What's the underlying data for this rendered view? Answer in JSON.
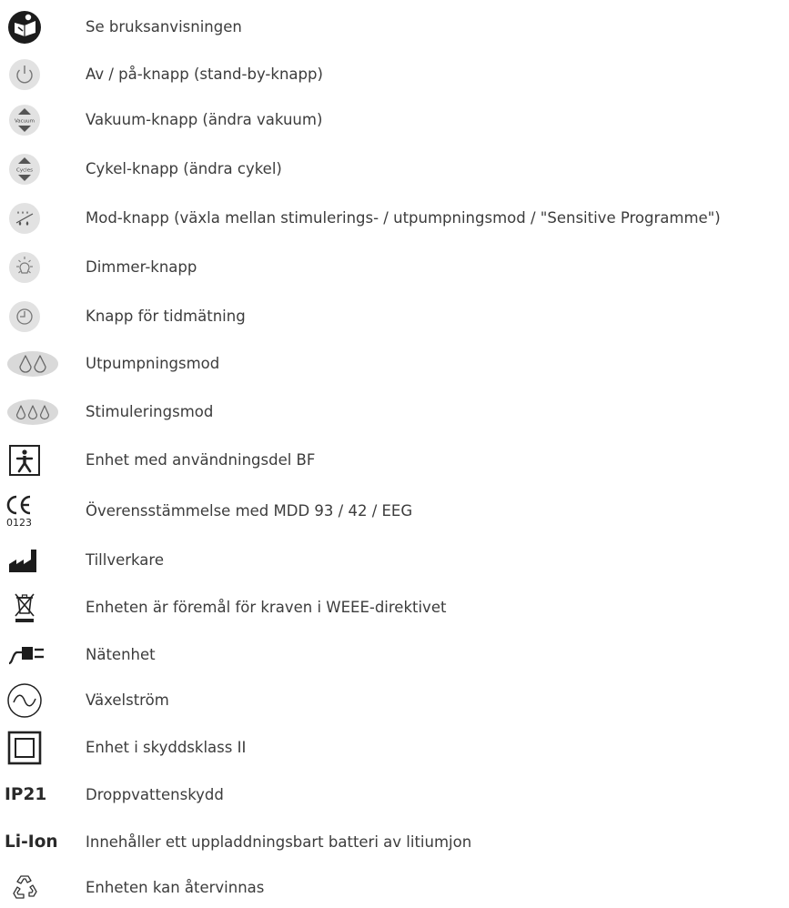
{
  "symbols": [
    {
      "icon": "instruction-manual-icon",
      "label": "Se bruksanvisningen"
    },
    {
      "icon": "power-button-icon",
      "label": "Av / på-knapp (stand-by-knapp)"
    },
    {
      "icon": "vacuum-button-icon",
      "icon_text": "Vacuum",
      "label": "Vakuum-knapp (ändra vakuum)"
    },
    {
      "icon": "cycle-button-icon",
      "icon_text": "Cycles",
      "label": "Cykel-knapp (ändra cykel)"
    },
    {
      "icon": "mode-button-icon",
      "label": "Mod-knapp (växla mellan stimulerings- / utpumpningsmod / \"Sensitive Programme\")"
    },
    {
      "icon": "dimmer-button-icon",
      "label": "Dimmer-knapp"
    },
    {
      "icon": "timer-button-icon",
      "label": "Knapp för tidmätning"
    },
    {
      "icon": "expression-mode-icon",
      "label": "Utpumpningsmod"
    },
    {
      "icon": "stimulation-mode-icon",
      "label": "Stimuleringsmod"
    },
    {
      "icon": "type-bf-applied-part-icon",
      "label": "Enhet med användningsdel BF"
    },
    {
      "icon": "ce-mark-icon",
      "icon_text": "0123",
      "label": "Överensstämmelse med MDD 93 / 42 / EEG"
    },
    {
      "icon": "manufacturer-icon",
      "label": "Tillverkare"
    },
    {
      "icon": "weee-bin-icon",
      "label": "Enheten är föremål för kraven i WEEE-direktivet"
    },
    {
      "icon": "power-supply-icon",
      "label": "Nätenhet"
    },
    {
      "icon": "alternating-current-icon",
      "label": "Växelström"
    },
    {
      "icon": "protection-class-2-icon",
      "label": "Enhet i skyddsklass II"
    },
    {
      "icon": "ip21-code",
      "code": "IP21",
      "label": "Droppvattenskydd"
    },
    {
      "icon": "li-ion-code",
      "code": "Li-Ion",
      "label": "Innehåller ett uppladdningsbart batteri av litiumjon"
    },
    {
      "icon": "recycling-icon",
      "label": "Enheten kan återvinnas"
    }
  ]
}
